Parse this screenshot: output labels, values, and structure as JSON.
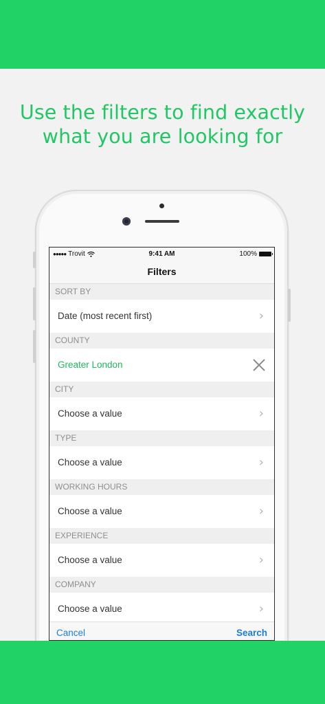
{
  "colors": {
    "brand_green": "#21d366",
    "link_blue": "#1a7dd9"
  },
  "headline": {
    "line1": "Use the filters to find exactly",
    "line2": "what you are looking for"
  },
  "status_bar": {
    "carrier": "Trovit",
    "time": "9:41 AM",
    "battery": "100%"
  },
  "nav": {
    "title": "Filters"
  },
  "sections": [
    {
      "header": "SORT BY",
      "value": "Date (most recent first)",
      "selected": false,
      "icon": "chevron-right-icon"
    },
    {
      "header": "COUNTY",
      "value": "Greater London",
      "selected": true,
      "icon": "close-icon"
    },
    {
      "header": "CITY",
      "value": "Choose a value",
      "selected": false,
      "icon": "chevron-right-icon"
    },
    {
      "header": "TYPE",
      "value": "Choose a value",
      "selected": false,
      "icon": "chevron-right-icon"
    },
    {
      "header": "WORKING HOURS",
      "value": "Choose a value",
      "selected": false,
      "icon": "chevron-right-icon"
    },
    {
      "header": "EXPERIENCE",
      "value": "Choose a value",
      "selected": false,
      "icon": "chevron-right-icon"
    },
    {
      "header": "COMPANY",
      "value": "Choose a value",
      "selected": false,
      "icon": "chevron-right-icon"
    }
  ],
  "toolbar": {
    "cancel_label": "Cancel",
    "search_label": "Search"
  }
}
